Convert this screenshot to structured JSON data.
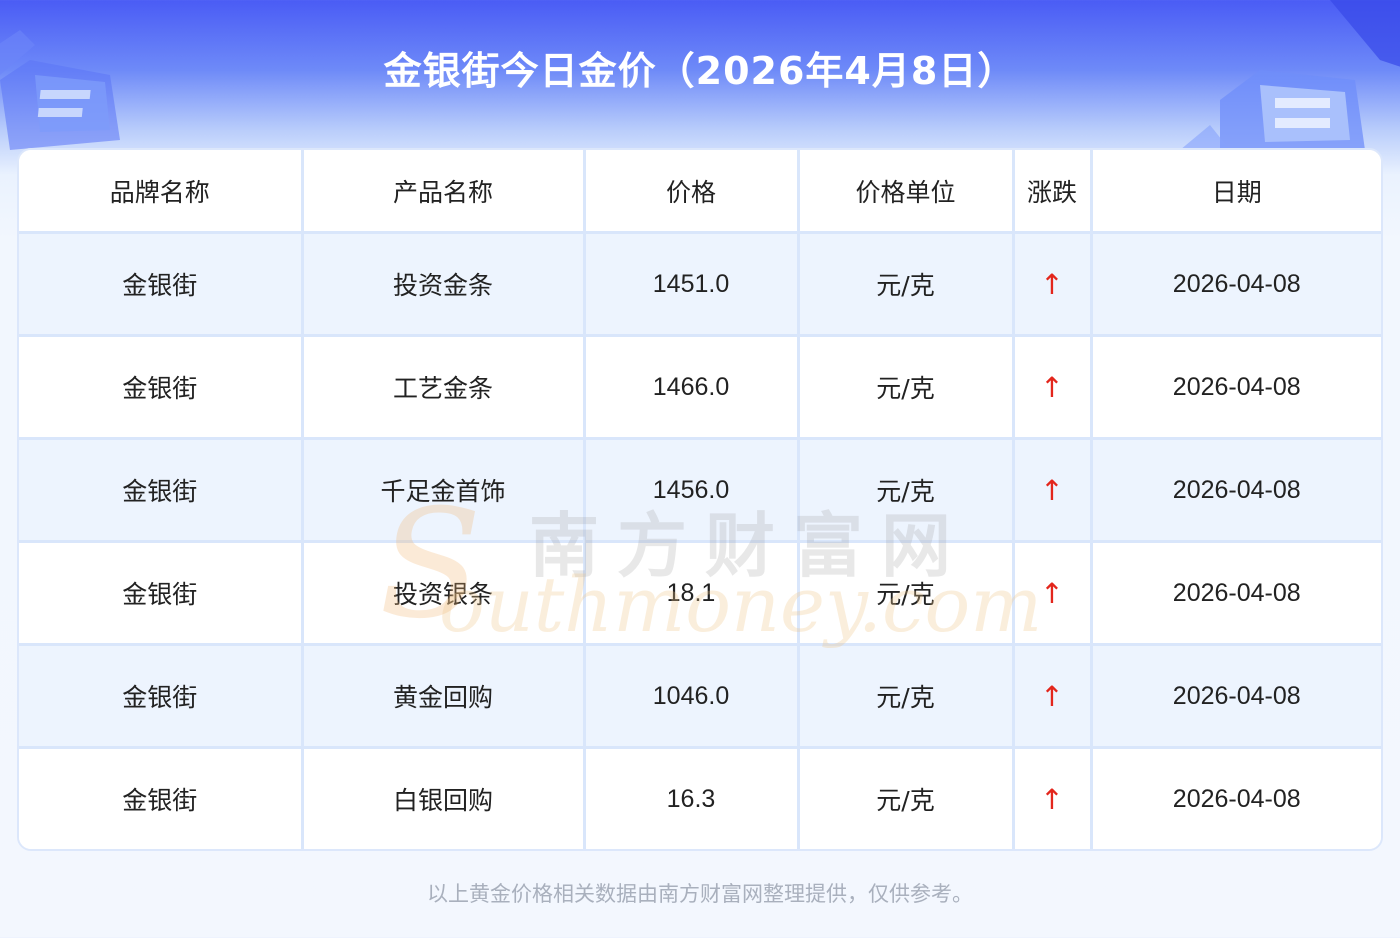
{
  "title": "金银街今日金价（2026年4月8日）",
  "table": {
    "headers": [
      "品牌名称",
      "产品名称",
      "价格",
      "价格单位",
      "涨跌",
      "日期"
    ],
    "rows": [
      {
        "brand": "金银街",
        "product": "投资金条",
        "price": "1451.0",
        "unit": "元/克",
        "change": "↑",
        "date": "2026-04-08"
      },
      {
        "brand": "金银街",
        "product": "工艺金条",
        "price": "1466.0",
        "unit": "元/克",
        "change": "↑",
        "date": "2026-04-08"
      },
      {
        "brand": "金银街",
        "product": "千足金首饰",
        "price": "1456.0",
        "unit": "元/克",
        "change": "↑",
        "date": "2026-04-08"
      },
      {
        "brand": "金银街",
        "product": "投资银条",
        "price": "18.1",
        "unit": "元/克",
        "change": "↑",
        "date": "2026-04-08"
      },
      {
        "brand": "金银街",
        "product": "黄金回购",
        "price": "1046.0",
        "unit": "元/克",
        "change": "↑",
        "date": "2026-04-08"
      },
      {
        "brand": "金银街",
        "product": "白银回购",
        "price": "16.3",
        "unit": "元/克",
        "change": "↑",
        "date": "2026-04-08"
      }
    ]
  },
  "watermark": {
    "cn": "南方财富网",
    "s": "S",
    "en": "outhmoney.com"
  },
  "footer": "以上黄金价格相关数据由南方财富网整理提供，仅供参考。",
  "colors": {
    "header_blue": "#4a5cf5",
    "up_arrow": "#e3261c",
    "row_alt": "#edf4fe",
    "grid": "#d9e6fb"
  },
  "icons": {
    "left": "gold-bars-illustration",
    "right": "gold-bars-illustration"
  }
}
